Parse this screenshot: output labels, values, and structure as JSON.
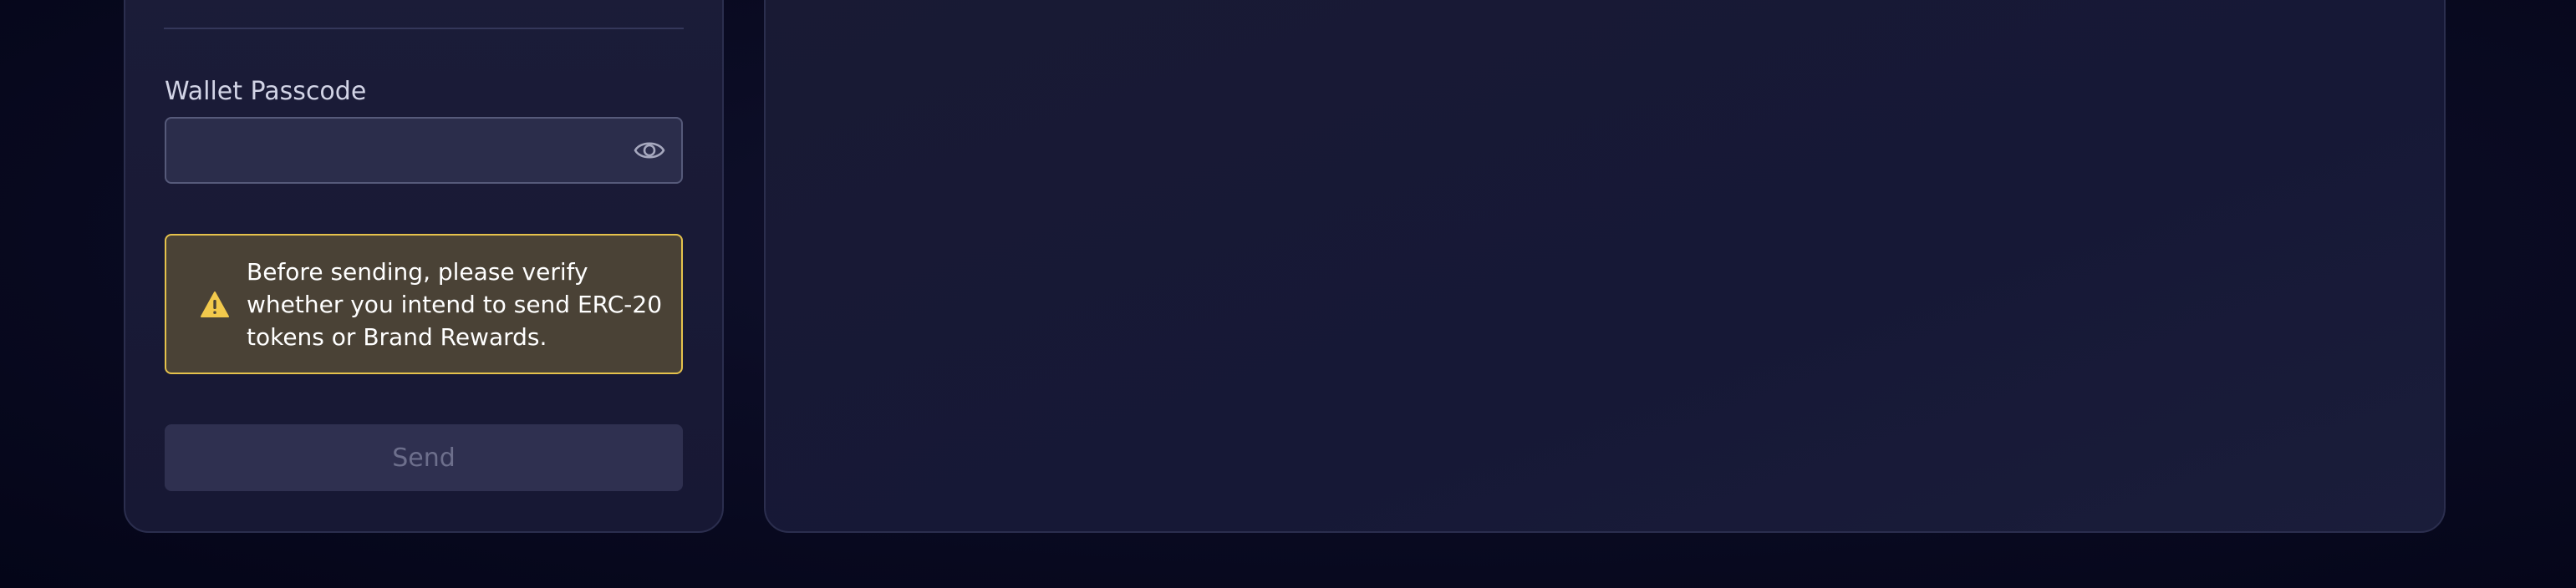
{
  "wallet_form": {
    "passcode_label": "Wallet Passcode",
    "passcode_value": "",
    "passcode_placeholder": "",
    "warning_text": "Before sending, please verify whether you intend to send ERC-20 tokens or Brand Rewards.",
    "send_label": "Send"
  },
  "icons": {
    "visibility_toggle": "eye-icon",
    "warning": "warning-triangle-icon"
  },
  "colors": {
    "warning_border": "#e5c24c",
    "warning_icon": "#f2c94c",
    "warning_background": "#4a4236",
    "send_disabled_background": "#2f3050",
    "send_disabled_text": "#6d6f8c"
  }
}
